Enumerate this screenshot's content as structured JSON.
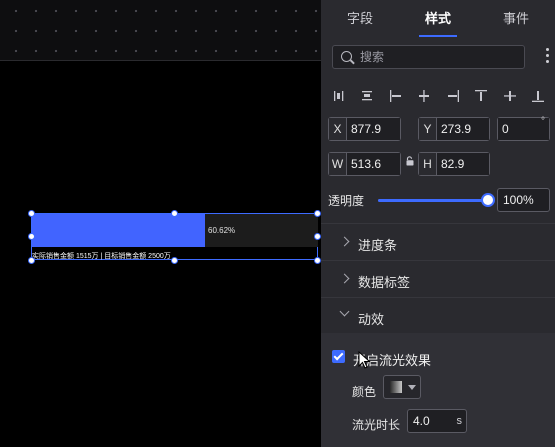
{
  "tabs": [
    {
      "label": "字段"
    },
    {
      "label": "样式"
    },
    {
      "label": "事件"
    }
  ],
  "active_tab": "样式",
  "search": {
    "placeholder": "搜索"
  },
  "align_icons": [
    "align-left-edge-icon",
    "align-h-center-icon",
    "align-left-icon",
    "align-center-icon",
    "align-right-icon",
    "align-top-icon",
    "align-middle-icon",
    "align-bottom-icon"
  ],
  "geometry": {
    "x_label": "X",
    "x_value": "877.9",
    "y_label": "Y",
    "y_value": "273.9",
    "rotation_value": "0",
    "rotation_unit": "°",
    "w_label": "W",
    "w_value": "513.6",
    "h_label": "H",
    "h_value": "82.9"
  },
  "opacity": {
    "label": "透明度",
    "value_text": "100%",
    "value": 1.0
  },
  "sections": [
    {
      "label": "进度条",
      "expanded": false
    },
    {
      "label": "数据标签",
      "expanded": false
    },
    {
      "label": "动效",
      "expanded": true
    }
  ],
  "effects": {
    "flow_light_label": "开启流光效果",
    "flow_light_checked": true,
    "color_label": "颜色",
    "duration_label": "流光时长",
    "duration_value": "4.0",
    "duration_unit": "s"
  },
  "widget": {
    "percent_text": "60.62%",
    "progress": 0.6062,
    "caption": "实际销售金额 1515万 | 目标销售金额 2500万"
  },
  "colors": {
    "accent": "#3d6bff",
    "bar_fill": "#4164ff",
    "panel_bg": "#2a2a2f"
  }
}
